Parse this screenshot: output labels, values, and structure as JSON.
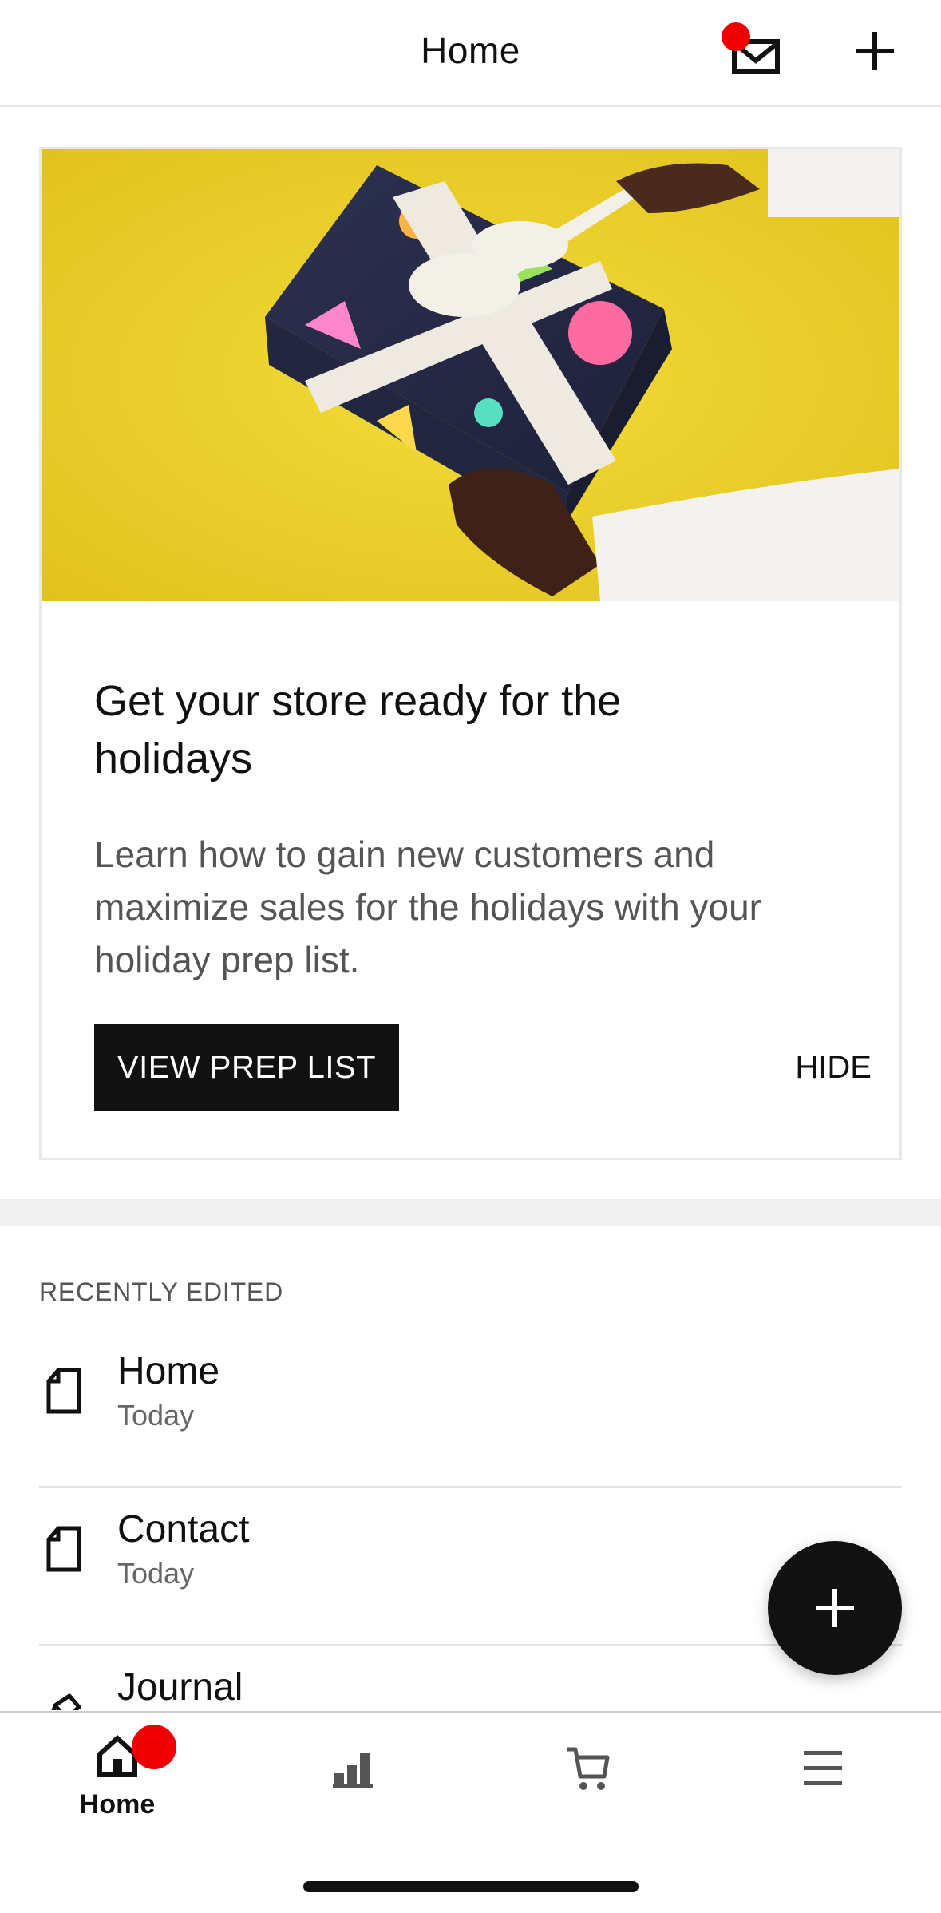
{
  "header": {
    "title": "Home",
    "mail_icon": "mail-icon",
    "add_icon": "plus-icon",
    "notification_color": "#ee0000"
  },
  "promo": {
    "image": "gift-box-photo",
    "title": "Get your store ready for the holidays",
    "body": "Learn how to gain new customers and maximize sales for the holidays with your holiday prep list.",
    "primary_label": "VIEW PREP LIST",
    "secondary_label": "HIDE"
  },
  "recent": {
    "label": "RECENTLY EDITED",
    "items": [
      {
        "title": "Home",
        "subtitle": "Today",
        "icon": "page-icon"
      },
      {
        "title": "Contact",
        "subtitle": "Today",
        "icon": "page-icon"
      },
      {
        "title": "Journal",
        "subtitle": "",
        "icon": "blog-pen-icon"
      }
    ]
  },
  "fab": {
    "icon": "plus-icon"
  },
  "tabbar": {
    "tabs": [
      {
        "label": "Home",
        "icon": "home-icon",
        "active": true
      },
      {
        "label": "",
        "icon": "analytics-icon",
        "active": false
      },
      {
        "label": "",
        "icon": "cart-icon",
        "active": false
      },
      {
        "label": "",
        "icon": "menu-icon",
        "active": false
      }
    ]
  }
}
